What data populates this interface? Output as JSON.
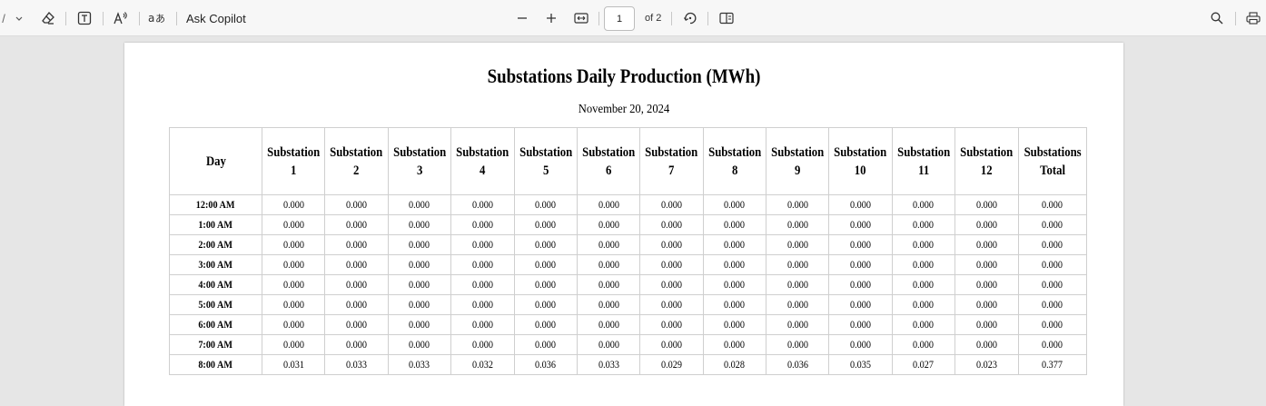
{
  "toolbar": {
    "left_partial": "/",
    "ask_copilot": "Ask Copilot",
    "page_number": "1",
    "page_of": "of 2",
    "icons": [
      "chevron-down-icon",
      "eraser-icon",
      "text-box-icon",
      "read-aloud-icon",
      "translate-icon",
      "zoom-out-icon",
      "zoom-in-icon",
      "fit-width-icon",
      "rotate-icon",
      "page-view-icon",
      "search-icon",
      "print-icon"
    ]
  },
  "document": {
    "title": "Substations Daily Production (MWh)",
    "date": "November 20, 2024",
    "table": {
      "headers": [
        [
          "Day"
        ],
        [
          "Substation",
          "1"
        ],
        [
          "Substation",
          "2"
        ],
        [
          "Substation",
          "3"
        ],
        [
          "Substation",
          "4"
        ],
        [
          "Substation",
          "5"
        ],
        [
          "Substation",
          "6"
        ],
        [
          "Substation",
          "7"
        ],
        [
          "Substation",
          "8"
        ],
        [
          "Substation",
          "9"
        ],
        [
          "Substation",
          "10"
        ],
        [
          "Substation",
          "11"
        ],
        [
          "Substation",
          "12"
        ],
        [
          "Substations",
          "Total"
        ]
      ],
      "rows": [
        [
          "12:00 AM",
          "0.000",
          "0.000",
          "0.000",
          "0.000",
          "0.000",
          "0.000",
          "0.000",
          "0.000",
          "0.000",
          "0.000",
          "0.000",
          "0.000",
          "0.000"
        ],
        [
          "1:00 AM",
          "0.000",
          "0.000",
          "0.000",
          "0.000",
          "0.000",
          "0.000",
          "0.000",
          "0.000",
          "0.000",
          "0.000",
          "0.000",
          "0.000",
          "0.000"
        ],
        [
          "2:00 AM",
          "0.000",
          "0.000",
          "0.000",
          "0.000",
          "0.000",
          "0.000",
          "0.000",
          "0.000",
          "0.000",
          "0.000",
          "0.000",
          "0.000",
          "0.000"
        ],
        [
          "3:00 AM",
          "0.000",
          "0.000",
          "0.000",
          "0.000",
          "0.000",
          "0.000",
          "0.000",
          "0.000",
          "0.000",
          "0.000",
          "0.000",
          "0.000",
          "0.000"
        ],
        [
          "4:00 AM",
          "0.000",
          "0.000",
          "0.000",
          "0.000",
          "0.000",
          "0.000",
          "0.000",
          "0.000",
          "0.000",
          "0.000",
          "0.000",
          "0.000",
          "0.000"
        ],
        [
          "5:00 AM",
          "0.000",
          "0.000",
          "0.000",
          "0.000",
          "0.000",
          "0.000",
          "0.000",
          "0.000",
          "0.000",
          "0.000",
          "0.000",
          "0.000",
          "0.000"
        ],
        [
          "6:00 AM",
          "0.000",
          "0.000",
          "0.000",
          "0.000",
          "0.000",
          "0.000",
          "0.000",
          "0.000",
          "0.000",
          "0.000",
          "0.000",
          "0.000",
          "0.000"
        ],
        [
          "7:00 AM",
          "0.000",
          "0.000",
          "0.000",
          "0.000",
          "0.000",
          "0.000",
          "0.000",
          "0.000",
          "0.000",
          "0.000",
          "0.000",
          "0.000",
          "0.000"
        ],
        [
          "8:00 AM",
          "0.031",
          "0.033",
          "0.033",
          "0.032",
          "0.036",
          "0.033",
          "0.029",
          "0.028",
          "0.036",
          "0.035",
          "0.027",
          "0.023",
          "0.377"
        ]
      ]
    }
  }
}
